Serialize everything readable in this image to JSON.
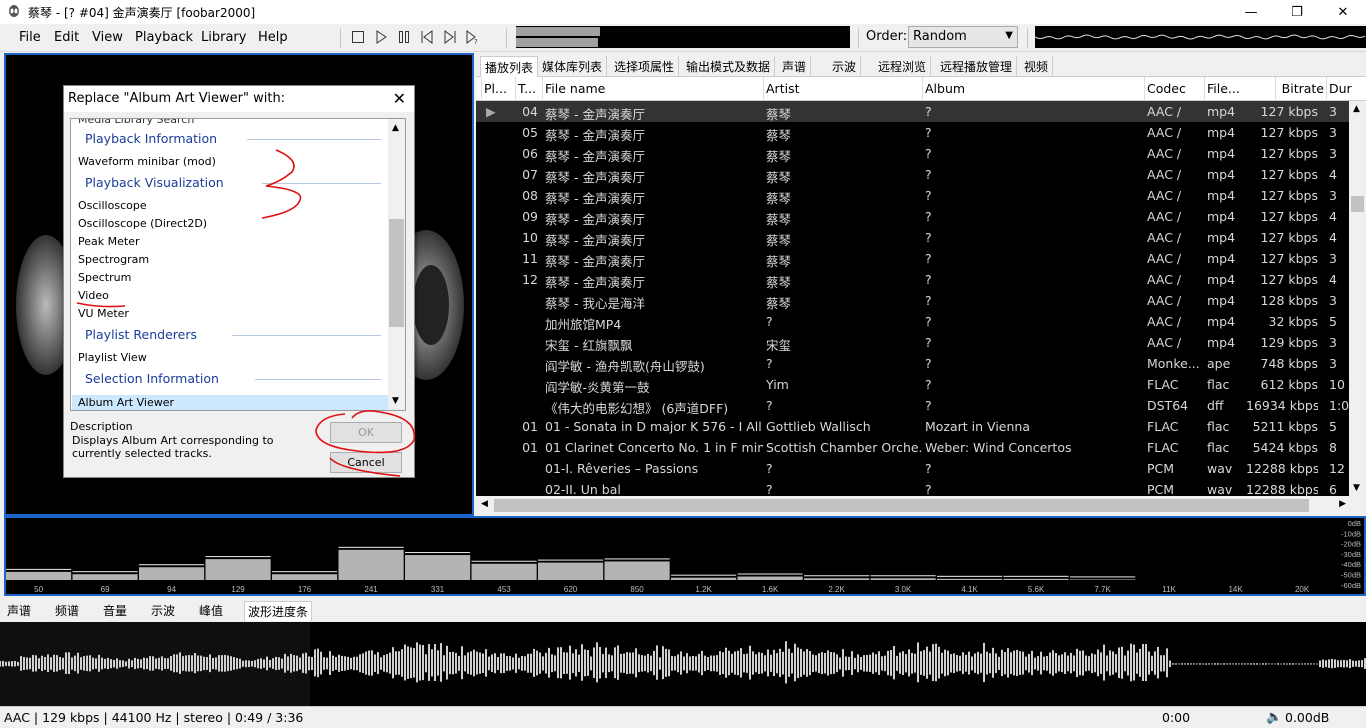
{
  "window": {
    "title": "蔡琴 - [? #04] 金声演奏厅  [foobar2000]"
  },
  "menu": [
    "File",
    "Edit",
    "View",
    "Playback",
    "Library",
    "Help"
  ],
  "order": {
    "label": "Order:",
    "value": "Random"
  },
  "dialog": {
    "title": "Replace \"Album Art Viewer\" with:",
    "clipped_item": "Media Library Search",
    "items": [
      {
        "kind": "header",
        "text": "Playback Information"
      },
      {
        "kind": "item",
        "text": "Waveform minibar (mod)"
      },
      {
        "kind": "header",
        "text": "Playback Visualization"
      },
      {
        "kind": "item",
        "text": "Oscilloscope"
      },
      {
        "kind": "item",
        "text": "Oscilloscope (Direct2D)"
      },
      {
        "kind": "item",
        "text": "Peak Meter"
      },
      {
        "kind": "item",
        "text": "Spectrogram"
      },
      {
        "kind": "item",
        "text": "Spectrum"
      },
      {
        "kind": "item",
        "text": "Video"
      },
      {
        "kind": "item",
        "text": "VU Meter"
      },
      {
        "kind": "header",
        "text": "Playlist Renderers"
      },
      {
        "kind": "item",
        "text": "Playlist View"
      },
      {
        "kind": "header",
        "text": "Selection Information"
      },
      {
        "kind": "item",
        "text": "Album Art Viewer",
        "selected": true
      }
    ],
    "description_label": "Description",
    "description": "Displays Album Art corresponding to currently selected tracks.",
    "ok": "OK",
    "cancel": "Cancel"
  },
  "playlist_tabs": [
    "播放列表",
    "媒体库列表",
    "选择项属性",
    "输出模式及数据",
    "声谱",
    "示波",
    "远程浏览",
    "远程播放管理",
    "视频"
  ],
  "columns": [
    "Pl...",
    "T...",
    "File name",
    "Artist",
    "Album",
    "Codec",
    "File...",
    "Bitrate",
    "Dur"
  ],
  "rows": [
    {
      "playing": true,
      "track": "04",
      "file": "蔡琴 - 金声演奏厅",
      "artist": "蔡琴",
      "album": "?",
      "codec": "AAC /",
      "ext": "mp4",
      "bitrate": "127 kbps",
      "dur": "3"
    },
    {
      "track": "05",
      "file": "蔡琴 - 金声演奏厅",
      "artist": "蔡琴",
      "album": "?",
      "codec": "AAC /",
      "ext": "mp4",
      "bitrate": "127 kbps",
      "dur": "3"
    },
    {
      "track": "06",
      "file": "蔡琴 - 金声演奏厅",
      "artist": "蔡琴",
      "album": "?",
      "codec": "AAC /",
      "ext": "mp4",
      "bitrate": "127 kbps",
      "dur": "3"
    },
    {
      "track": "07",
      "file": "蔡琴 - 金声演奏厅",
      "artist": "蔡琴",
      "album": "?",
      "codec": "AAC /",
      "ext": "mp4",
      "bitrate": "127 kbps",
      "dur": "4"
    },
    {
      "track": "08",
      "file": "蔡琴 - 金声演奏厅",
      "artist": "蔡琴",
      "album": "?",
      "codec": "AAC /",
      "ext": "mp4",
      "bitrate": "127 kbps",
      "dur": "3"
    },
    {
      "track": "09",
      "file": "蔡琴 - 金声演奏厅",
      "artist": "蔡琴",
      "album": "?",
      "codec": "AAC /",
      "ext": "mp4",
      "bitrate": "127 kbps",
      "dur": "4"
    },
    {
      "track": "10",
      "file": "蔡琴 - 金声演奏厅",
      "artist": "蔡琴",
      "album": "?",
      "codec": "AAC /",
      "ext": "mp4",
      "bitrate": "127 kbps",
      "dur": "4"
    },
    {
      "track": "11",
      "file": "蔡琴 - 金声演奏厅",
      "artist": "蔡琴",
      "album": "?",
      "codec": "AAC /",
      "ext": "mp4",
      "bitrate": "127 kbps",
      "dur": "3"
    },
    {
      "track": "12",
      "file": "蔡琴 - 金声演奏厅",
      "artist": "蔡琴",
      "album": "?",
      "codec": "AAC /",
      "ext": "mp4",
      "bitrate": "127 kbps",
      "dur": "4"
    },
    {
      "track": "",
      "file": "蔡琴 - 我心是海洋",
      "artist": "蔡琴",
      "album": "?",
      "codec": "AAC /",
      "ext": "mp4",
      "bitrate": "128 kbps",
      "dur": "3"
    },
    {
      "track": "",
      "file": "加州旅馆MP4",
      "artist": "?",
      "album": "?",
      "codec": "AAC /",
      "ext": "mp4",
      "bitrate": "32 kbps",
      "dur": "5"
    },
    {
      "track": "",
      "file": "宋玺 - 红旗飘飘",
      "artist": "宋玺",
      "album": "?",
      "codec": "AAC /",
      "ext": "mp4",
      "bitrate": "129 kbps",
      "dur": "3"
    },
    {
      "track": "",
      "file": "阎学敏 - 渔舟凯歌(舟山锣鼓)",
      "artist": "?",
      "album": "?",
      "codec": "Monke...",
      "ext": "ape",
      "bitrate": "748 kbps",
      "dur": "3"
    },
    {
      "track": "",
      "file": "阎学敏-炎黄第一鼓",
      "artist": "Yim",
      "album": "?",
      "codec": "FLAC",
      "ext": "flac",
      "bitrate": "612 kbps",
      "dur": "10"
    },
    {
      "track": "",
      "file": "《伟大的电影幻想》 (6声道DFF)",
      "artist": "?",
      "album": "?",
      "codec": "DST64",
      "ext": "dff",
      "bitrate": "16934 kbps",
      "dur": "1:01"
    },
    {
      "track": "01",
      "file": "01 - Sonata in D major K 576 - I All...",
      "artist": "Gottlieb Wallisch",
      "album": "Mozart in Vienna",
      "codec": "FLAC",
      "ext": "flac",
      "bitrate": "5211 kbps",
      "dur": "5"
    },
    {
      "track": "01",
      "file": "01 Clarinet Concerto No. 1 in F min...",
      "artist": "Scottish Chamber Orche...",
      "album": "Weber: Wind Concertos",
      "codec": "FLAC",
      "ext": "flac",
      "bitrate": "5424 kbps",
      "dur": "8"
    },
    {
      "track": "",
      "file": "01-I. Rêveries – Passions",
      "artist": "?",
      "album": "?",
      "codec": "PCM",
      "ext": "wav",
      "bitrate": "12288 kbps",
      "dur": "12"
    },
    {
      "track": "",
      "file": "02-II. Un bal",
      "artist": "?",
      "album": "?",
      "codec": "PCM",
      "ext": "wav",
      "bitrate": "12288 kbps",
      "dur": "6"
    }
  ],
  "spectrum": {
    "freq_labels": [
      "50",
      "69",
      "94",
      "129",
      "176",
      "241",
      "331",
      "453",
      "620",
      "850",
      "1.2K",
      "1.6K",
      "2.2K",
      "3.0K",
      "4.1K",
      "5.6K",
      "7.7K",
      "11K",
      "14K",
      "20K"
    ],
    "db_labels": [
      "0dB",
      "-10dB",
      "-20dB",
      "-30dB",
      "-40dB",
      "-50dB",
      "-60dB"
    ],
    "levels": [
      0.14,
      0.1,
      0.22,
      0.36,
      0.1,
      0.52,
      0.43,
      0.28,
      0.3,
      0.32,
      0.04,
      0.06,
      0.03,
      0.03,
      0.02,
      0.02,
      0.01,
      0.0,
      0.0,
      0.0
    ]
  },
  "vis_tabs": [
    "声谱",
    "频谱",
    "音量",
    "示波",
    "峰值",
    "波形进度条"
  ],
  "vis_active": 5,
  "status": {
    "info": "AAC | 129 kbps | 44100 Hz | stereo | 0:49 / 3:36",
    "time": "0:00",
    "volume": "0.00dB"
  }
}
